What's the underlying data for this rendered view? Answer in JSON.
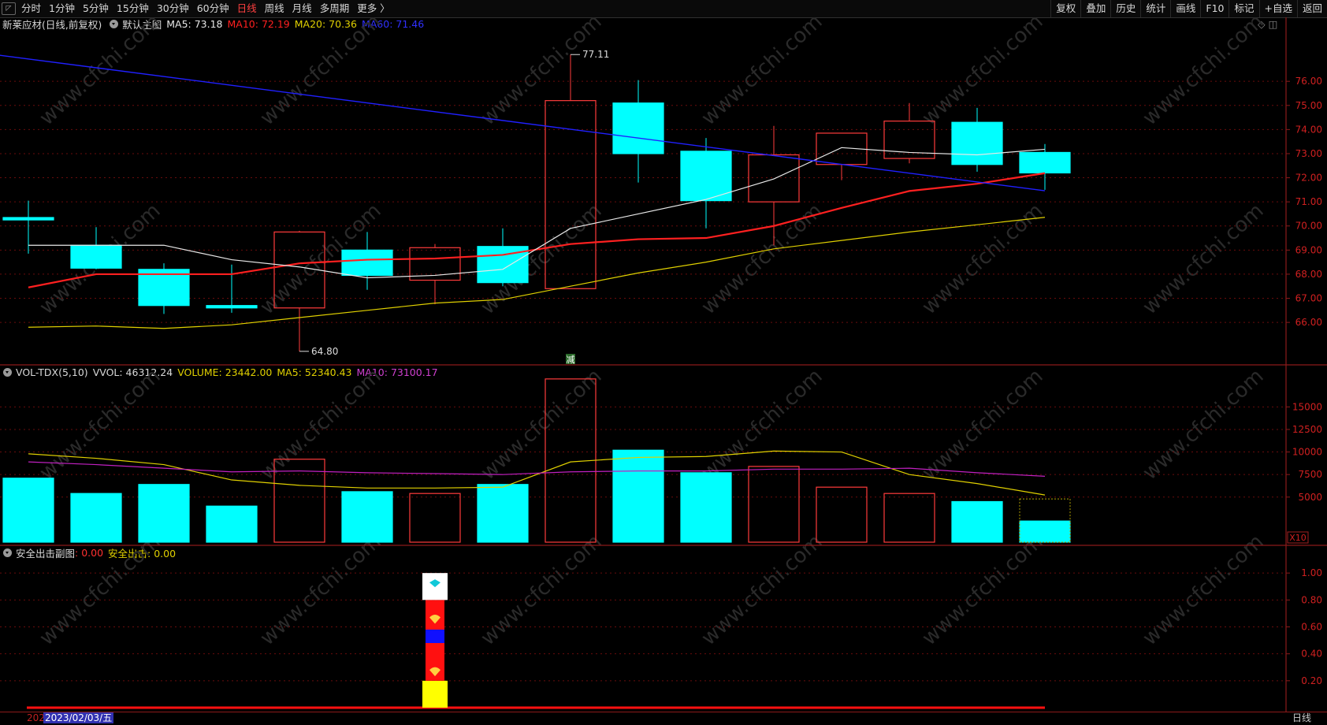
{
  "toolbar": {
    "logo": "◸",
    "periods": [
      "分时",
      "1分钟",
      "5分钟",
      "15分钟",
      "30分钟",
      "60分钟",
      "日线",
      "周线",
      "月线",
      "多周期",
      "更多 〉"
    ],
    "active_period": "日线",
    "right_items": [
      "复权",
      "叠加",
      "历史",
      "统计",
      "画线",
      "F10",
      "标记",
      "+自选",
      "返回"
    ]
  },
  "main_info": {
    "title": "新莱应材(日线,前复权)",
    "indicator": "默认主图",
    "ma5": "MA5: 73.18",
    "ma10": "MA10: 72.19",
    "ma20": "MA20: 70.36",
    "ma60": "MA60: 71.46",
    "right_icons": "◇ ◫"
  },
  "main_chart": {
    "price_min": 64.5,
    "price_max": 78,
    "price_ticks": [
      "76.00",
      "75.00",
      "74.00",
      "73.00",
      "72.00",
      "71.00",
      "70.00",
      "69.00",
      "68.00",
      "67.00",
      "66.00"
    ],
    "high_label": "77.11",
    "low_label": "64.80",
    "marker": "减",
    "candles": [
      {
        "o": 70.35,
        "h": 71.05,
        "l": 68.85,
        "c": 70.25
      },
      {
        "o": 69.2,
        "h": 69.95,
        "l": 68.2,
        "c": 68.25
      },
      {
        "o": 68.2,
        "h": 68.45,
        "l": 66.35,
        "c": 66.7
      },
      {
        "o": 66.7,
        "h": 68.4,
        "l": 66.4,
        "c": 66.6
      },
      {
        "o": 66.6,
        "h": 69.8,
        "l": 64.8,
        "c": 69.75
      },
      {
        "o": 69.0,
        "h": 69.75,
        "l": 67.35,
        "c": 67.95
      },
      {
        "o": 67.75,
        "h": 69.25,
        "l": 66.75,
        "c": 69.1
      },
      {
        "o": 69.15,
        "h": 69.9,
        "l": 67.5,
        "c": 67.65
      },
      {
        "o": 67.4,
        "h": 77.11,
        "l": 67.4,
        "c": 75.2
      },
      {
        "o": 75.1,
        "h": 76.05,
        "l": 71.8,
        "c": 73.0
      },
      {
        "o": 73.1,
        "h": 73.65,
        "l": 69.9,
        "c": 71.05
      },
      {
        "o": 71.0,
        "h": 74.15,
        "l": 69.2,
        "c": 72.95
      },
      {
        "o": 72.55,
        "h": 73.85,
        "l": 71.9,
        "c": 73.85
      },
      {
        "o": 72.8,
        "h": 75.1,
        "l": 72.6,
        "c": 74.35
      },
      {
        "o": 74.3,
        "h": 74.9,
        "l": 72.25,
        "c": 72.55
      },
      {
        "o": 73.05,
        "h": 73.4,
        "l": 71.5,
        "c": 72.2
      }
    ],
    "ma5_line": [
      69.2,
      69.2,
      69.2,
      68.6,
      68.3,
      67.85,
      67.95,
      68.2,
      69.9,
      70.5,
      71.1,
      71.95,
      73.25,
      73.05,
      72.95,
      73.18
    ],
    "ma10_line": [
      67.45,
      68.0,
      68.0,
      68.0,
      68.45,
      68.6,
      68.65,
      68.8,
      69.25,
      69.45,
      69.5,
      70.0,
      70.75,
      71.45,
      71.75,
      72.19
    ],
    "ma20_line": [
      65.8,
      65.85,
      65.75,
      65.9,
      66.2,
      66.5,
      66.8,
      66.95,
      67.5,
      68.05,
      68.5,
      69.05,
      69.4,
      69.75,
      70.05,
      70.36
    ],
    "ma60_line": [
      [
        -0.75,
        77.2
      ],
      [
        15,
        71.46
      ]
    ]
  },
  "volume_info": {
    "title": "VOL-TDX(5,10)",
    "vvol": "VVOL: 46312.24",
    "volume": "VOLUME: 23442.00",
    "ma5": "MA5: 52340.43",
    "ma10": "MA10: 73100.17"
  },
  "volume_chart": {
    "max": 18000,
    "ticks": [
      "15000",
      "12500",
      "10000",
      "7500",
      "5000"
    ],
    "unit_label": "X10",
    "bars": [
      {
        "v": 7100,
        "up": false
      },
      {
        "v": 5400,
        "up": false
      },
      {
        "v": 6400,
        "up": false
      },
      {
        "v": 4000,
        "up": false
      },
      {
        "v": 9200,
        "up": true
      },
      {
        "v": 5600,
        "up": false
      },
      {
        "v": 5400,
        "up": true
      },
      {
        "v": 6400,
        "up": false
      },
      {
        "v": 18100,
        "up": true
      },
      {
        "v": 10200,
        "up": false
      },
      {
        "v": 7700,
        "up": false
      },
      {
        "v": 8400,
        "up": true
      },
      {
        "v": 6100,
        "up": true
      },
      {
        "v": 5400,
        "up": true
      },
      {
        "v": 4500,
        "up": false
      },
      {
        "v": 2344,
        "up": false
      }
    ],
    "current_outline": 4800,
    "ma5_line": [
      9800,
      9300,
      8600,
      6900,
      6300,
      6000,
      6000,
      6100,
      8900,
      9400,
      9500,
      10100,
      10000,
      7500,
      6500,
      5234
    ],
    "ma10_line": [
      8900,
      8600,
      8200,
      7800,
      7900,
      7700,
      7600,
      7500,
      7800,
      7900,
      7900,
      8100,
      8100,
      8200,
      7700,
      7310
    ]
  },
  "sub_info": {
    "title": "安全出击副图",
    "label1": ": 0.00",
    "label2": "安全出击: 0.00"
  },
  "sub_chart": {
    "ticks": [
      "1.00",
      "0.80",
      "0.60",
      "0.40",
      "0.20"
    ],
    "signal_bar": 6
  },
  "bottom": {
    "year_partial": "202",
    "date": "2023/02/03/五",
    "period": "日线"
  },
  "colors": {
    "up": "#ff3b3b",
    "down": "#00ffff",
    "ma5": "#e8e8e8",
    "ma10": "#ff2020",
    "ma20": "#e0d000",
    "ma60": "#2020ff",
    "grid": "#6a0c0c",
    "axis": "#8b1a1a",
    "vol_ma10": "#c020c0"
  }
}
